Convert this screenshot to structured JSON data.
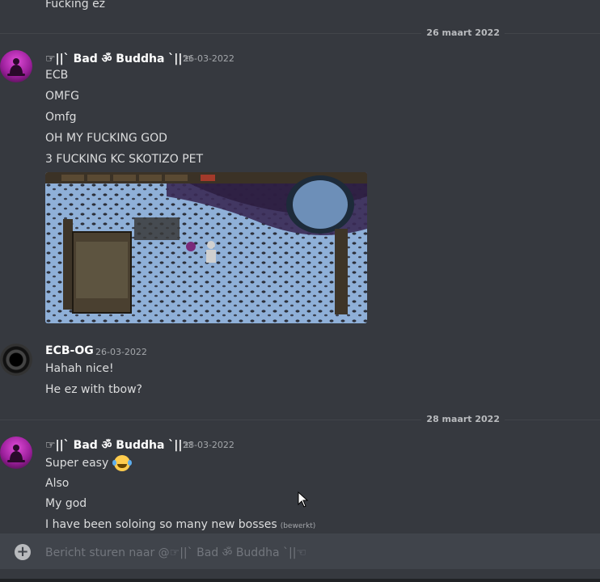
{
  "messages_top": {
    "prev_line": "Fucking ez"
  },
  "divider_1": {
    "label": "26 maart 2022"
  },
  "group_1": {
    "author": "☞||` Bad ॐ Buddha `||☜",
    "timestamp": "26-03-2022",
    "lines": [
      "ECB",
      "OMFG",
      "Omfg",
      "OH MY FUCKING GOD",
      "3 FUCKING KC SKOTIZO PET"
    ],
    "attachment": "osrs-screenshot"
  },
  "group_2": {
    "author": "ECB-OG",
    "timestamp": "26-03-2022",
    "lines": [
      "Hahah nice!",
      "He ez with tbow?"
    ]
  },
  "divider_2": {
    "label": "28 maart 2022"
  },
  "group_3": {
    "author": "☞||` Bad ॐ Buddha `||☜",
    "timestamp": "28-03-2022",
    "lines": [
      "Super easy",
      "Also",
      "My god",
      "I have been soloing so many new bosses"
    ],
    "edited": "(bewerkt)",
    "emoji": "joy-emoji"
  },
  "composer": {
    "placeholder": "Bericht sturen naar @☞||` Bad ॐ Buddha `||☜"
  },
  "colors": {
    "background": "#36393f",
    "input": "#40444b",
    "text": "#dcddde",
    "muted": "#a3a6aa"
  }
}
